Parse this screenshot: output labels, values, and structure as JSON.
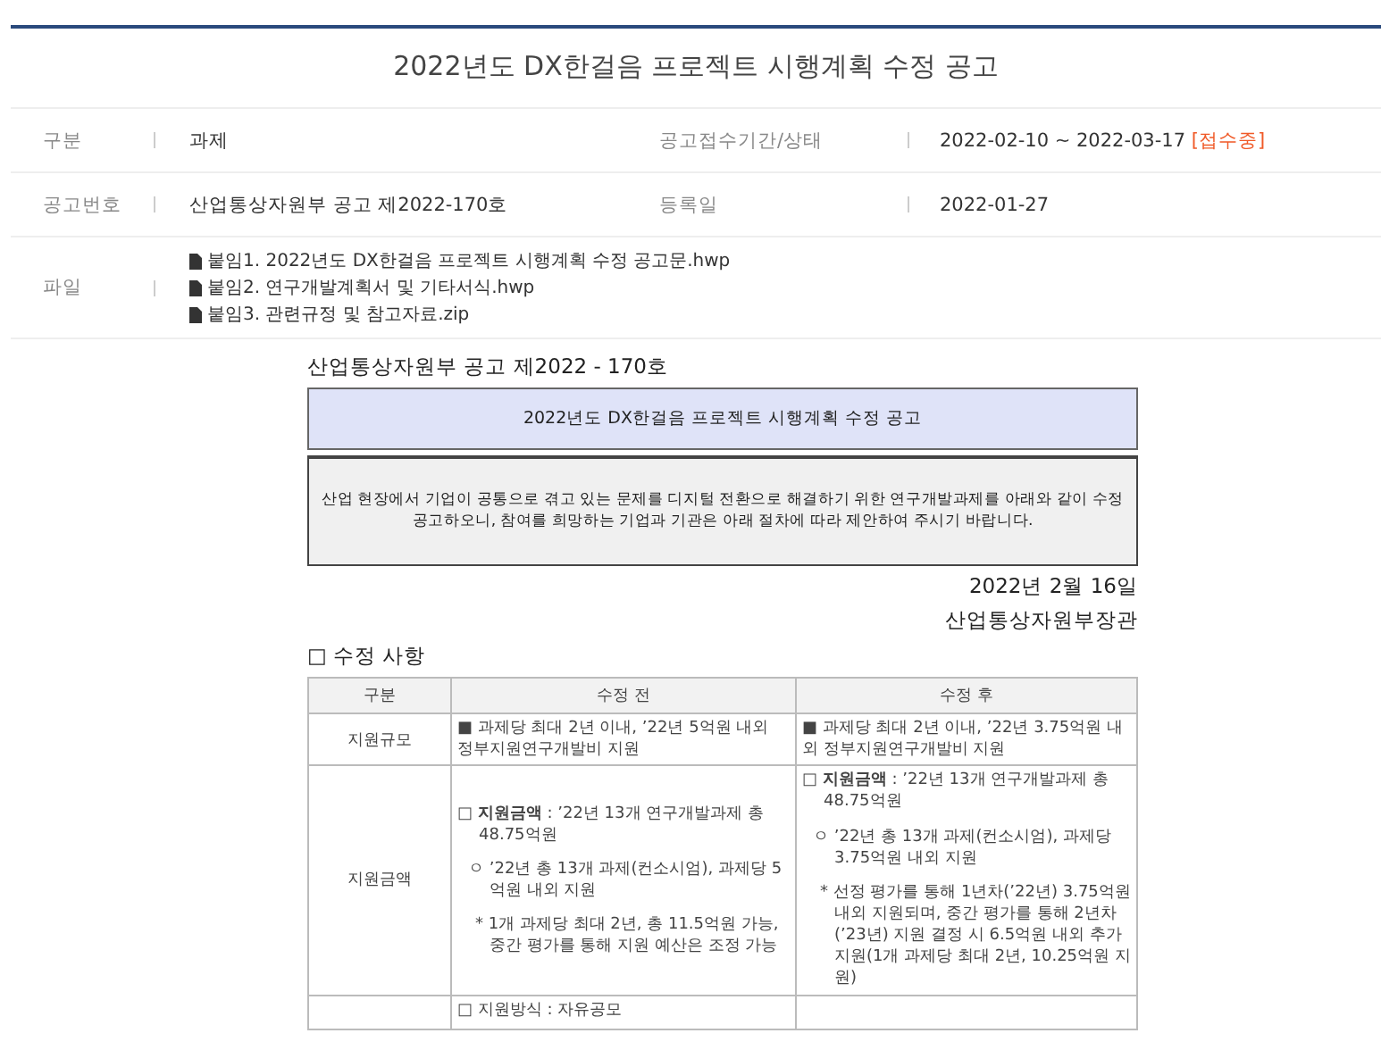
{
  "title": "2022년도 DX한걸음 프로젝트 시행계획 수정 공고",
  "meta_rows": [
    {
      "label": "구분",
      "value": "과제",
      "label_2": "공고접수기간/상태",
      "value_2": "2022-02-10 ~ 2022-03-17",
      "status": "[접수중]"
    },
    {
      "label": "공고번호",
      "value": "산업통상자원부 공고 제2022-170호",
      "label_2": "등록일",
      "value_2": "2022-01-27"
    }
  ],
  "files": {
    "label": "파일",
    "items": [
      "붙임1. 2022년도 DX한걸음 프로젝트 시행계획 수정 공고문.hwp",
      "붙임2. 연구개발계획서 및 기타서식.hwp",
      "붙임3. 관련규정 및 참고자료.zip"
    ]
  },
  "document": {
    "notice_number": "산업통상자원부 공고 제2022 - 170호",
    "heading": "2022년도 DX한걸음 프로젝트 시행계획 수정 공고",
    "intro": "산업 현장에서 기업이 공통으로 겪고 있는 문제를 디지털 전환으로 해결하기 위한 연구개발과제를 아래와 같이 수정 공고하오니, 참여를 희망하는 기업과 기관은 아래 절차에 따라 제안하여 주시기 바랍니다.",
    "date": "2022년 2월 16일",
    "issuer": "산업통상자원부장관",
    "section": "□ 수정 사항",
    "table": {
      "columns": [
        "구분",
        "수정 전",
        "수정 후"
      ],
      "rows": [
        {
          "label": "지원규모",
          "before": [
            {
              "kind": "plain",
              "text": "■ 과제당 최대 2년 이내, ’22년 5억원 내외 정부지원연구개발비 지원"
            }
          ],
          "after": [
            {
              "kind": "plain",
              "text": "■ 과제당 최대 2년 이내, ’22년 3.75억원 내외 정부지원연구개발비 지원"
            }
          ]
        },
        {
          "label": "지원금액",
          "before": [
            {
              "kind": "box",
              "text": "□ **지원금액** : ’22년 13개 연구개발과제 총 48.75억원"
            },
            {
              "kind": "circle",
              "text": "ㅇ ’22년 총 13개 과제(컨소시엄), 과제당 5억원 내외 지원"
            },
            {
              "kind": "note",
              "text": "* 1개 과제당 최대 2년, 총 11.5억원 가능, 중간 평가를 통해 지원 예산은 조정 가능"
            }
          ],
          "after": [
            {
              "kind": "box",
              "text": "□ **지원금액** : ’22년 13개 연구개발과제 총 48.75억원"
            },
            {
              "kind": "circle",
              "text": "ㅇ ’22년 총 13개 과제(컨소시엄), 과제당 3.75억원 내외 지원"
            },
            {
              "kind": "note",
              "text": "* 선정 평가를 통해 1년차(’22년) 3.75억원 내외 지원되며, 중간 평가를 통해 2년차(’23년) 지원 결정 시 6.5억원 내외 추가지원(1개 과제당 최대 2년, 10.25억원 지원)"
            }
          ]
        },
        {
          "label": "",
          "before": [
            {
              "kind": "box",
              "text": "□ 지원방식 : 자유공모"
            }
          ],
          "after": []
        }
      ]
    }
  }
}
